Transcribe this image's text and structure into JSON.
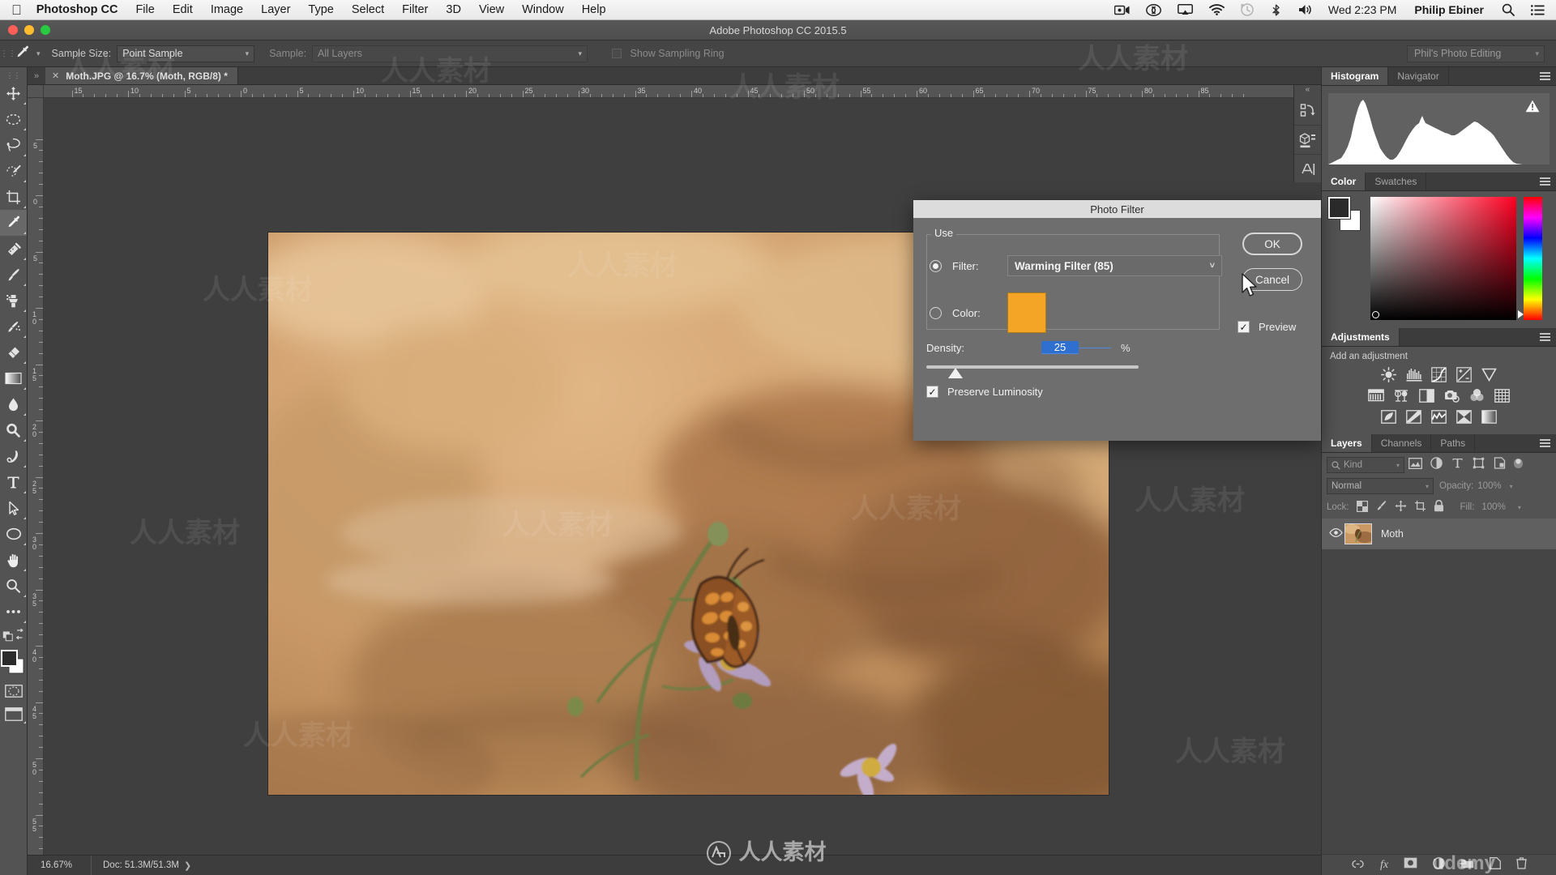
{
  "macbar": {
    "apple_icon": "apple-logo-icon",
    "app_name": "Photoshop CC",
    "menus": [
      "File",
      "Edit",
      "Image",
      "Layer",
      "Type",
      "Select",
      "Filter",
      "3D",
      "View",
      "Window",
      "Help"
    ],
    "status_icons": [
      "screen-record-icon",
      "creative-cloud-icon",
      "airplay-icon",
      "wifi-icon",
      "time-machine-icon",
      "bluetooth-icon",
      "volume-icon"
    ],
    "clock": "Wed 2:23 PM",
    "user": "Philip Ebiner",
    "search_icon": "search-icon",
    "notification_icon": "notification-center-icon"
  },
  "window": {
    "title": "Adobe Photoshop CC 2015.5",
    "traffic": {
      "close": "#ff5f57",
      "minimize": "#febc2e",
      "zoom": "#28c840"
    }
  },
  "options_bar": {
    "tool_icon": "eyedropper-icon",
    "sample_size_label": "Sample Size:",
    "sample_size_value": "Point Sample",
    "sample_label": "Sample:",
    "sample_value": "All Layers",
    "show_sampling_ring_label": "Show Sampling Ring",
    "show_sampling_ring_checked": false,
    "workspace": "Phil's Photo Editing"
  },
  "toolbar": {
    "tools": [
      {
        "name": "move-tool",
        "selected": false
      },
      {
        "name": "marquee-tool",
        "selected": false
      },
      {
        "name": "lasso-tool",
        "selected": false
      },
      {
        "name": "quick-selection-tool",
        "selected": false
      },
      {
        "name": "crop-tool",
        "selected": false
      },
      {
        "name": "eyedropper-tool",
        "selected": true
      },
      {
        "name": "healing-brush-tool",
        "selected": false
      },
      {
        "name": "brush-tool",
        "selected": false
      },
      {
        "name": "clone-stamp-tool",
        "selected": false
      },
      {
        "name": "history-brush-tool",
        "selected": false
      },
      {
        "name": "eraser-tool",
        "selected": false
      },
      {
        "name": "gradient-tool",
        "selected": false
      },
      {
        "name": "blur-tool",
        "selected": false
      },
      {
        "name": "dodge-tool",
        "selected": false
      },
      {
        "name": "pen-tool",
        "selected": false
      },
      {
        "name": "type-tool",
        "selected": false
      },
      {
        "name": "path-selection-tool",
        "selected": false
      },
      {
        "name": "ellipse-shape-tool",
        "selected": false
      },
      {
        "name": "hand-tool",
        "selected": false
      },
      {
        "name": "zoom-tool",
        "selected": false
      },
      {
        "name": "edit-toolbar-tool",
        "selected": false
      }
    ],
    "foreground_color": "#2b2b2b",
    "background_color": "#ffffff"
  },
  "document": {
    "tab_title": "Moth.JPG @ 16.7% (Moth, RGB/8) *",
    "close_icon": "close-icon",
    "expand_icon": "expand-panels-icon",
    "ruler_h_labels": [
      "15",
      "10",
      "5",
      "0",
      "5",
      "10",
      "15",
      "20",
      "25",
      "30",
      "35",
      "40",
      "45",
      "50",
      "55",
      "60",
      "65",
      "70",
      "75",
      "80",
      "85"
    ],
    "ruler_v_labels": [
      "5",
      "0",
      "5",
      "10",
      "15",
      "20",
      "25",
      "30",
      "35",
      "40",
      "45",
      "50",
      "55"
    ]
  },
  "status_bar": {
    "zoom": "16.67%",
    "doc_info": "Doc: 51.3M/51.3M",
    "arrow_icon": "chevron-right-icon"
  },
  "icon_strip": {
    "collapse_icon": "collapse-panels-icon",
    "items": [
      "history-actions-icon",
      "3d-properties-icon",
      "character-icon"
    ]
  },
  "panels": {
    "histogram": {
      "tabs": [
        "Histogram",
        "Navigator"
      ],
      "active_tab": "Histogram",
      "menu_icon": "panel-menu-icon",
      "warning_icon": "cached-data-warning-icon"
    },
    "color": {
      "tabs": [
        "Color",
        "Swatches"
      ],
      "active_tab": "Color",
      "menu_icon": "panel-menu-icon",
      "foreground": "#2b2b2b",
      "background": "#ffffff"
    },
    "adjustments": {
      "title": "Adjustments",
      "subtitle": "Add an adjustment",
      "menu_icon": "panel-menu-icon",
      "rows": [
        [
          "brightness-contrast-icon",
          "levels-icon",
          "curves-icon",
          "exposure-icon",
          "vibrance-icon"
        ],
        [
          "hue-saturation-icon",
          "color-balance-icon",
          "black-white-icon",
          "photo-filter-icon",
          "channel-mixer-icon",
          "color-lookup-icon"
        ],
        [
          "invert-icon",
          "posterize-icon",
          "threshold-icon",
          "selective-color-icon",
          "gradient-map-icon"
        ]
      ]
    },
    "layers": {
      "tabs": [
        "Layers",
        "Channels",
        "Paths"
      ],
      "active_tab": "Layers",
      "menu_icon": "panel-menu-icon",
      "filter_kind": "Kind",
      "filter_search_icon": "search-icon",
      "filter_icons": [
        "filter-pixel-icon",
        "filter-adjustment-icon",
        "filter-type-icon",
        "filter-shape-icon",
        "filter-smart-object-icon"
      ],
      "filter_toggle_icon": "filter-toggle-icon",
      "blend_mode": "Normal",
      "opacity_label": "Opacity:",
      "opacity_value": "100%",
      "lock_label": "Lock:",
      "lock_icons": [
        "lock-transparency-icon",
        "lock-image-icon",
        "lock-position-icon",
        "lock-artboard-icon",
        "lock-all-icon"
      ],
      "fill_label": "Fill:",
      "fill_value": "100%",
      "items": [
        {
          "name": "Moth",
          "visible": true,
          "visibility_icon": "eye-icon"
        }
      ],
      "footer_icons": [
        "link-layers-icon",
        "add-style-fx-icon",
        "add-mask-icon",
        "new-adjustment-icon",
        "new-group-icon",
        "new-layer-icon",
        "delete-layer-icon"
      ]
    }
  },
  "dialog": {
    "title": "Photo Filter",
    "group_label": "Use",
    "filter_radio_label": "Filter:",
    "filter_radio_selected": true,
    "filter_value": "Warming Filter (85)",
    "filter_dropdown_icon": "chevron-down-icon",
    "color_radio_label": "Color:",
    "color_radio_selected": false,
    "color_value": "#f5a525",
    "density_label": "Density:",
    "density_value": "25",
    "density_unit": "%",
    "preserve_luminosity_label": "Preserve Luminosity",
    "preserve_luminosity_checked": true,
    "preview_label": "Preview",
    "preview_checked": true,
    "ok_label": "OK",
    "cancel_label": "Cancel",
    "cursor_icon": "mouse-cursor-icon"
  },
  "watermark": {
    "center_text": "人人素材",
    "corner_text": "udemy"
  }
}
